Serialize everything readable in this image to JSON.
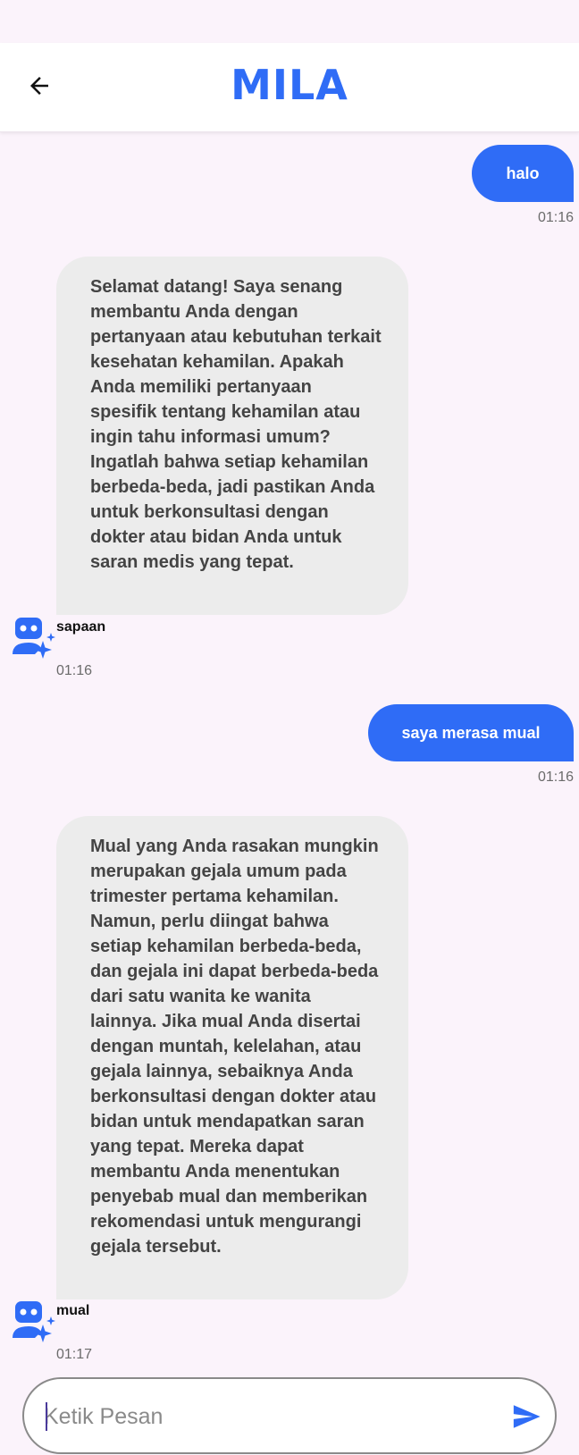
{
  "header": {
    "title": "MILA",
    "back_icon": "arrow-left-icon"
  },
  "colors": {
    "accent": "#2f6cf6",
    "background": "#fbf3fb",
    "bot_bubble": "#ececec"
  },
  "messages": [
    {
      "sender": "user",
      "text": "halo",
      "time": "01:16"
    },
    {
      "sender": "bot",
      "text": "Selamat datang! Saya senang membantu Anda dengan pertanyaan atau kebutuhan terkait kesehatan kehamilan. Apakah Anda memiliki pertanyaan spesifik tentang kehamilan atau ingin tahu informasi umum? Ingatlah bahwa setiap kehamilan berbeda-beda, jadi pastikan Anda untuk berkonsultasi dengan dokter atau bidan Anda untuk saran medis yang tepat.",
      "intent": "sapaan",
      "time": "01:16"
    },
    {
      "sender": "user",
      "text": "saya merasa mual",
      "time": "01:16"
    },
    {
      "sender": "bot",
      "text": "Mual yang Anda rasakan mungkin merupakan gejala umum pada trimester pertama kehamilan. Namun, perlu diingat bahwa setiap kehamilan berbeda-beda, dan gejala ini dapat berbeda-beda dari satu wanita ke wanita lainnya. Jika mual Anda disertai dengan muntah, kelelahan, atau gejala lainnya, sebaiknya Anda berkonsultasi dengan dokter atau bidan untuk mendapatkan saran yang tepat. Mereka dapat membantu Anda menentukan penyebab mual dan memberikan rekomendasi untuk mengurangi gejala tersebut.",
      "intent": "mual",
      "time": "01:17"
    }
  ],
  "composer": {
    "placeholder": "Ketik Pesan",
    "value": "",
    "send_icon": "send-icon"
  }
}
